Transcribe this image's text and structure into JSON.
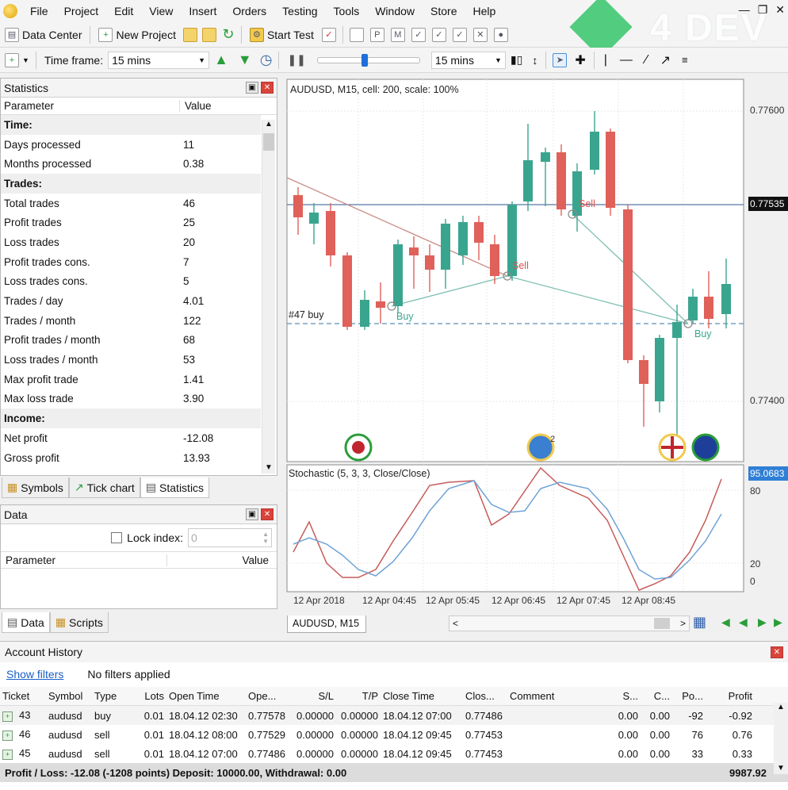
{
  "menu": [
    "File",
    "Project",
    "Edit",
    "View",
    "Insert",
    "Orders",
    "Testing",
    "Tools",
    "Window",
    "Store",
    "Help"
  ],
  "logo_text": "4 DEV",
  "toolbar1": {
    "data_center": "Data Center",
    "new_project": "New Project",
    "start_test": "Start Test"
  },
  "toolbar2": {
    "time_frame_label": "Time frame:",
    "time_frame_value": "15 mins",
    "speed_value": "15 mins",
    "slider_level": 0.45
  },
  "statistics": {
    "title": "Statistics",
    "col_parameter": "Parameter",
    "col_value": "Value",
    "rows": [
      {
        "label": "Time:",
        "value": "",
        "section": true
      },
      {
        "label": "Days processed",
        "value": "11"
      },
      {
        "label": "Months processed",
        "value": "0.38"
      },
      {
        "label": "Trades:",
        "value": "",
        "section": true
      },
      {
        "label": "Total trades",
        "value": "46"
      },
      {
        "label": "Profit trades",
        "value": "25"
      },
      {
        "label": "Loss trades",
        "value": "20"
      },
      {
        "label": "Profit trades cons.",
        "value": "7"
      },
      {
        "label": "Loss trades cons.",
        "value": "5"
      },
      {
        "label": "Trades / day",
        "value": "4.01"
      },
      {
        "label": "Trades / month",
        "value": "122"
      },
      {
        "label": "Profit trades / month",
        "value": "68"
      },
      {
        "label": "Loss trades / month",
        "value": "53"
      },
      {
        "label": "Max profit trade",
        "value": "1.41"
      },
      {
        "label": "Max loss trade",
        "value": "3.90"
      },
      {
        "label": "Income:",
        "value": "",
        "section": true
      },
      {
        "label": "Net profit",
        "value": "-12.08"
      },
      {
        "label": "Gross profit",
        "value": "13.93"
      }
    ]
  },
  "left_tabs": {
    "symbols": "Symbols",
    "tick_chart": "Tick chart",
    "statistics": "Statistics"
  },
  "data_panel": {
    "title": "Data",
    "lock_index": "Lock index:",
    "lock_value": "0",
    "col_parameter": "Parameter",
    "col_value": "Value"
  },
  "bottom_tabs": {
    "data": "Data",
    "scripts": "Scripts"
  },
  "chart": {
    "header": "AUDUSD, M15, cell: 200, scale: 100%",
    "price_labels": [
      "0.77600",
      "0.77400"
    ],
    "current_price": "0.77535",
    "buy_line_label": "#47 buy",
    "marker_labels": [
      "Sell",
      "Sell",
      "Buy",
      "Buy"
    ],
    "flag_badge": "2",
    "stoch_header": "Stochastic (5, 3, 3, Close/Close)",
    "stoch_current": "95.0683",
    "stoch_levels": [
      "80",
      "20",
      "0"
    ],
    "time_labels": [
      "12 Apr 2018",
      "12 Apr 04:45",
      "12 Apr 05:45",
      "12 Apr 06:45",
      "12 Apr 07:45",
      "12 Apr 08:45"
    ],
    "tab": "AUDUSD, M15"
  },
  "history": {
    "title": "Account History",
    "show_filters": "Show filters",
    "filter_status": "No filters applied",
    "columns": [
      "Ticket",
      "Symbol",
      "Type",
      "Lots",
      "Open Time",
      "Ope...",
      "S/L",
      "T/P",
      "Close Time",
      "Clos...",
      "Comment",
      "S...",
      "C...",
      "Po...",
      "Profit"
    ],
    "rows": [
      [
        "43",
        "audusd",
        "buy",
        "0.01",
        "18.04.12 02:30",
        "0.77578",
        "0.00000",
        "0.00000",
        "18.04.12 07:00",
        "0.77486",
        "",
        "0.00",
        "0.00",
        "-92",
        "-0.92"
      ],
      [
        "46",
        "audusd",
        "sell",
        "0.01",
        "18.04.12 08:00",
        "0.77529",
        "0.00000",
        "0.00000",
        "18.04.12 09:45",
        "0.77453",
        "",
        "0.00",
        "0.00",
        "76",
        "0.76"
      ],
      [
        "45",
        "audusd",
        "sell",
        "0.01",
        "18.04.12 07:00",
        "0.77486",
        "0.00000",
        "0.00000",
        "18.04.12 09:45",
        "0.77453",
        "",
        "0.00",
        "0.00",
        "33",
        "0.33"
      ]
    ],
    "total": "Profit / Loss: -12.08 (-1208 points) Deposit: 10000.00, Withdrawal: 0.00",
    "balance": "9987.92"
  }
}
